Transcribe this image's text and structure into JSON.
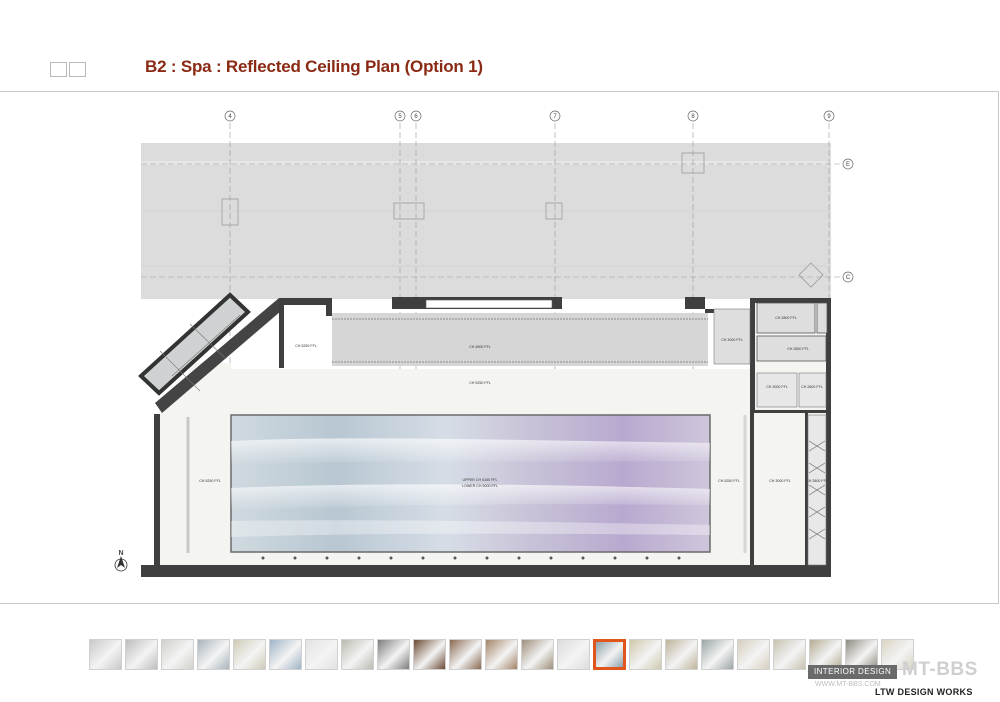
{
  "title": "B2 : Spa : Reflected Ceiling Plan (Option 1)",
  "colors": {
    "title": "#8b2a14",
    "active_thumb": "#e0561c"
  },
  "grid_axes": {
    "top": [
      "4",
      "5",
      "6",
      "7",
      "8",
      "9"
    ],
    "right": [
      "E",
      "C"
    ]
  },
  "north_label": "N",
  "room_labels": {
    "left_room": "CH 5250 FFL",
    "top_corridor": "CH 4500 FFL",
    "upper_band": "CH 5250 FFL",
    "right_room_1": "CH 3000 FFL",
    "right_room_2": "CH 2800 FFL",
    "right_room_3": "CH 2800 FFL",
    "right_room_4": "CH 3000 FFL",
    "right_room_5": "CH 2800 FFL",
    "left_wall_zone": "CH 5250 FFL",
    "right_wall_zone": "CH 5250 FFL",
    "pool_upper": "UPPER CH 6150 FFL",
    "pool_lower": "LOWER CH 5000 FFL",
    "far_right_1": "CH 3000 FFL",
    "far_right_2": "CH 2800 FFL"
  },
  "thumbnails": {
    "count": 23,
    "active_index": 14
  },
  "watermark": {
    "badge": "INTERIOR DESIGN",
    "brand": "MT-BBS",
    "url": "WWW.MT-BBS.COM"
  },
  "logo": "LTW DESIGN WORKS"
}
